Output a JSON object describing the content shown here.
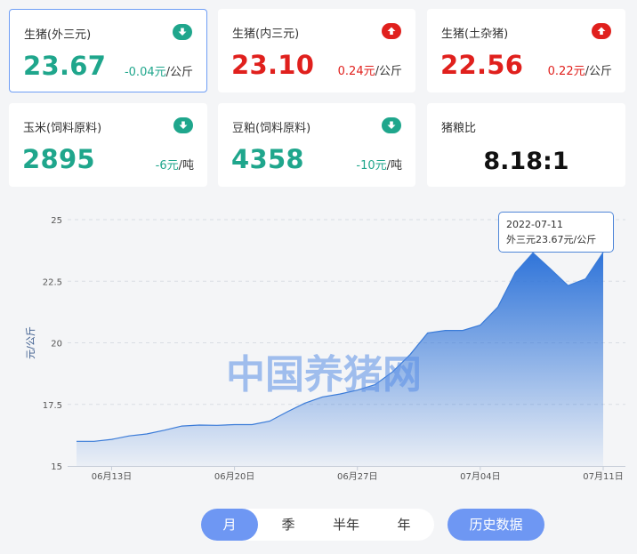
{
  "cards": [
    {
      "name": "生猪(外三元)",
      "price": "23.67",
      "change": "-0.04元",
      "unit": "/公斤",
      "trend": "down",
      "selected": true
    },
    {
      "name": "生猪(内三元)",
      "price": "23.10",
      "change": "0.24元",
      "unit": "/公斤",
      "trend": "up",
      "selected": false
    },
    {
      "name": "生猪(土杂猪)",
      "price": "22.56",
      "change": "0.22元",
      "unit": "/公斤",
      "trend": "up",
      "selected": false
    },
    {
      "name": "玉米(饲料原料)",
      "price": "2895",
      "change": "-6元",
      "unit": "/吨",
      "trend": "down",
      "selected": false
    },
    {
      "name": "豆粕(饲料原料)",
      "price": "4358",
      "change": "-10元",
      "unit": "/吨",
      "trend": "down",
      "selected": false
    },
    {
      "name": "猪粮比",
      "ratio": "8.18:1"
    }
  ],
  "colors": {
    "down": "#1fa68c",
    "up": "#e0201d",
    "accent": "#6e97f3",
    "area": "#3b7ddc"
  },
  "chart_data": {
    "type": "area",
    "x": [
      "06-11",
      "06-12",
      "06-13",
      "06-14",
      "06-15",
      "06-16",
      "06-17",
      "06-18",
      "06-19",
      "06-20",
      "06-21",
      "06-22",
      "06-23",
      "06-24",
      "06-25",
      "06-26",
      "06-27",
      "06-28",
      "06-29",
      "06-30",
      "07-01",
      "07-02",
      "07-03",
      "07-04",
      "07-05",
      "07-06",
      "07-07",
      "07-08",
      "07-09",
      "07-10",
      "07-11"
    ],
    "values": [
      16.0,
      16.0,
      16.08,
      16.22,
      16.3,
      16.45,
      16.62,
      16.66,
      16.65,
      16.68,
      16.68,
      16.82,
      17.2,
      17.55,
      17.8,
      17.92,
      18.08,
      18.3,
      18.82,
      19.52,
      20.4,
      20.5,
      20.5,
      20.72,
      21.45,
      22.85,
      23.65,
      23.0,
      22.32,
      22.6,
      23.67
    ],
    "x_tick_labels": [
      "06月13日",
      "06月20日",
      "06月27日",
      "07月04日",
      "07月11日"
    ],
    "x_tick_index": [
      2,
      9,
      16,
      23,
      30
    ],
    "y_ticks": [
      "15",
      "17.5",
      "20",
      "22.5",
      "25"
    ],
    "ylim": [
      15,
      25
    ],
    "ylabel": "元/公斤",
    "grid": true,
    "watermark": "中国养猪网"
  },
  "tooltip": {
    "date": "2022-07-11",
    "text": "外三元23.67元/公斤"
  },
  "periods": [
    {
      "label": "月",
      "active": true
    },
    {
      "label": "季",
      "active": false
    },
    {
      "label": "半年",
      "active": false
    },
    {
      "label": "年",
      "active": false
    }
  ],
  "history_label": "历史数据"
}
